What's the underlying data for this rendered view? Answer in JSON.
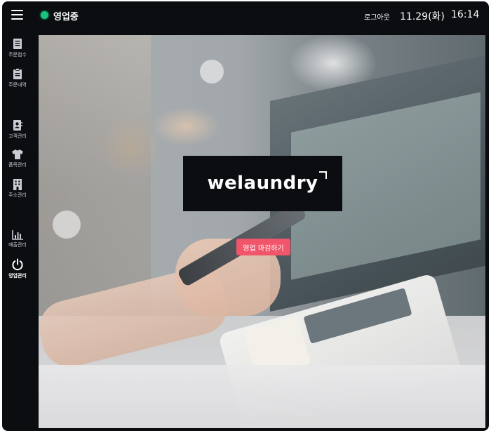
{
  "topbar": {
    "menu_icon": "hamburger-menu-icon",
    "status_label": "영업중",
    "status_color": "#19c37d",
    "logout_label": "로그아웃",
    "date": "11.29(화)",
    "time": "16:14"
  },
  "sidebar": {
    "items": [
      {
        "label": "주문접수",
        "icon": "clipboard-list-icon"
      },
      {
        "label": "주문내역",
        "icon": "clipboard-history-icon"
      },
      {
        "label": "고객관리",
        "icon": "contact-book-icon"
      },
      {
        "label": "품목관리",
        "icon": "tshirt-icon"
      },
      {
        "label": "주소관리",
        "icon": "building-icon"
      },
      {
        "label": "매출관리",
        "icon": "bar-chart-icon"
      },
      {
        "label": "영업관리",
        "icon": "power-icon",
        "active": true
      }
    ]
  },
  "main": {
    "logo_text": "welaundry",
    "close_button_label": "영업 마감하기",
    "close_button_color": "#f0556a"
  }
}
